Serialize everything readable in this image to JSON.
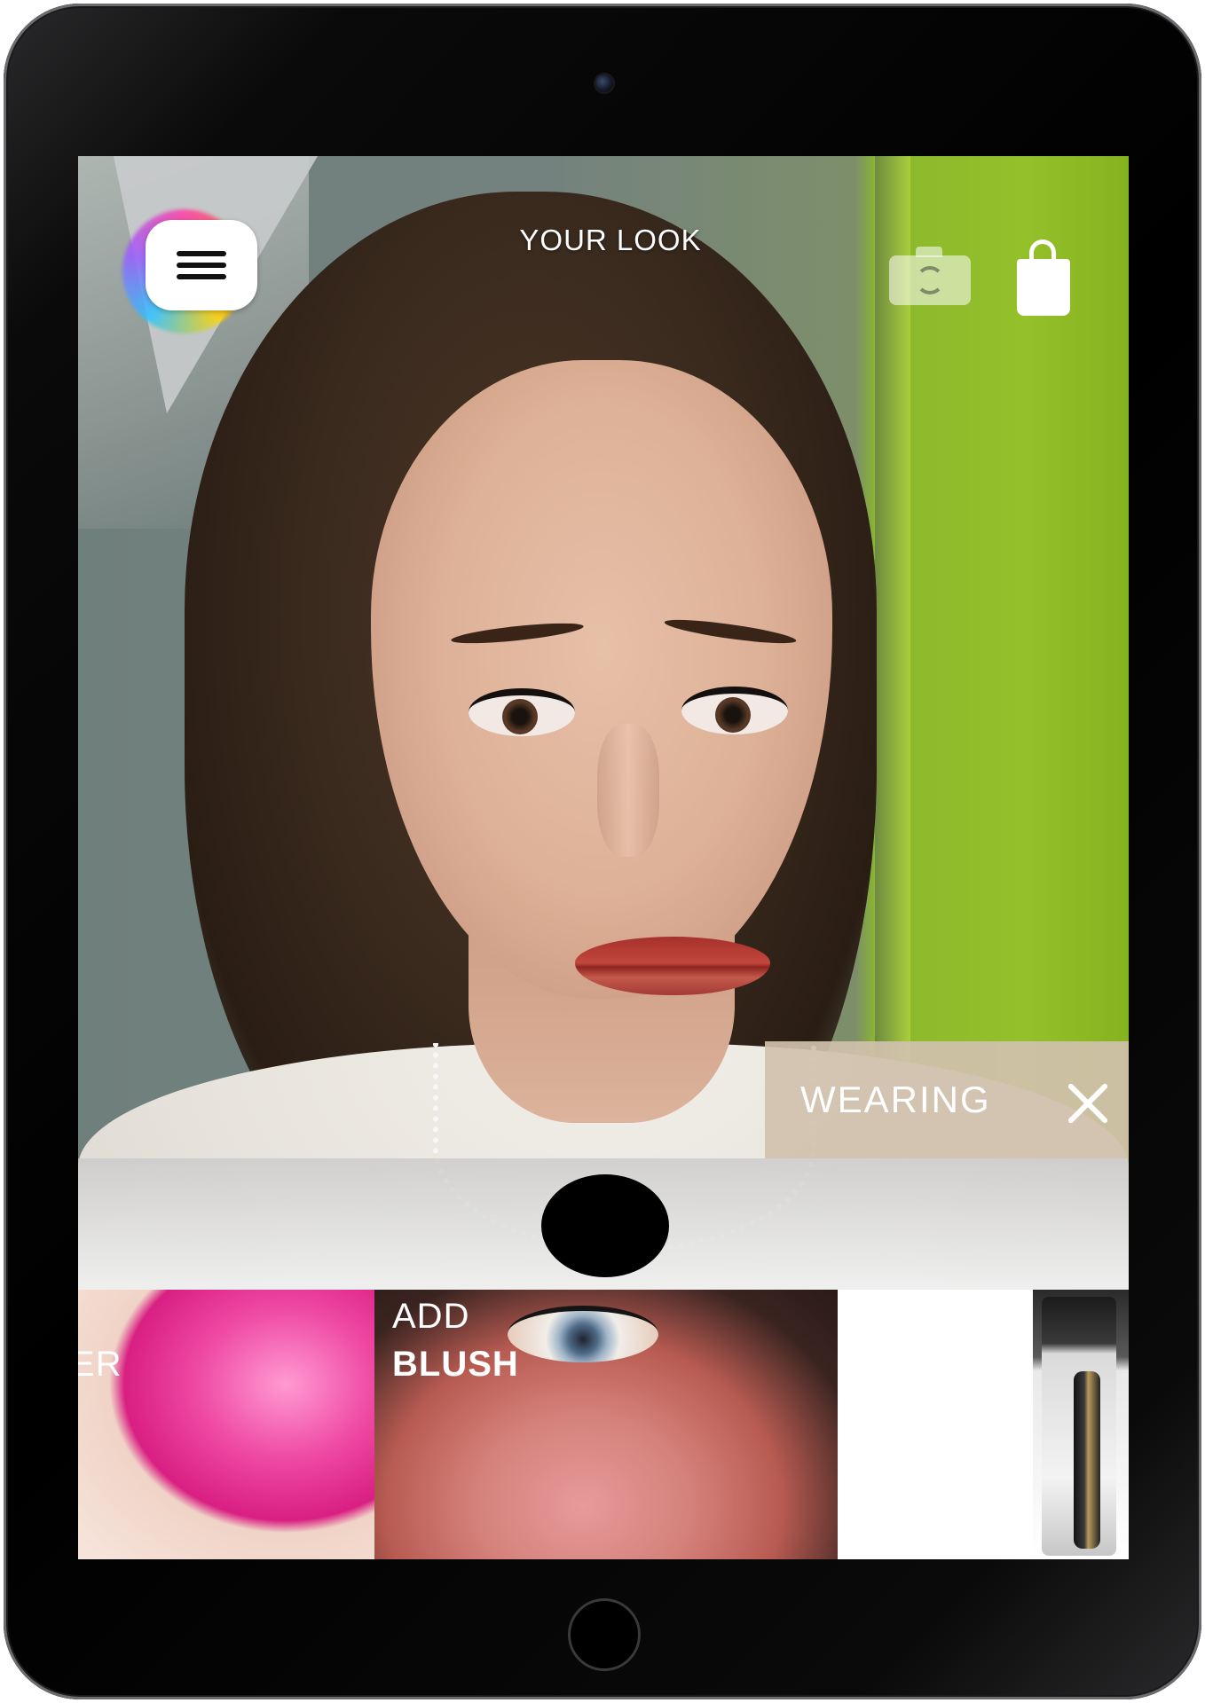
{
  "header": {
    "title": "YOUR LOOK"
  },
  "wearing": {
    "label": "WEARING"
  },
  "carousel": {
    "tiles": [
      {
        "label": "ER"
      },
      {
        "label_top": "ADD",
        "label_main": "BLUSH"
      },
      {
        "label": ""
      },
      {
        "label": ""
      }
    ]
  },
  "icons": {
    "menu": "hamburger-menu-icon",
    "camera_switch": "camera-switch-icon",
    "bag": "shopping-bag-icon",
    "close": "close-icon",
    "shutter": "shutter-button"
  },
  "colors": {
    "accent_beige": "#D0C1AC",
    "wall_green": "#94C02A"
  }
}
